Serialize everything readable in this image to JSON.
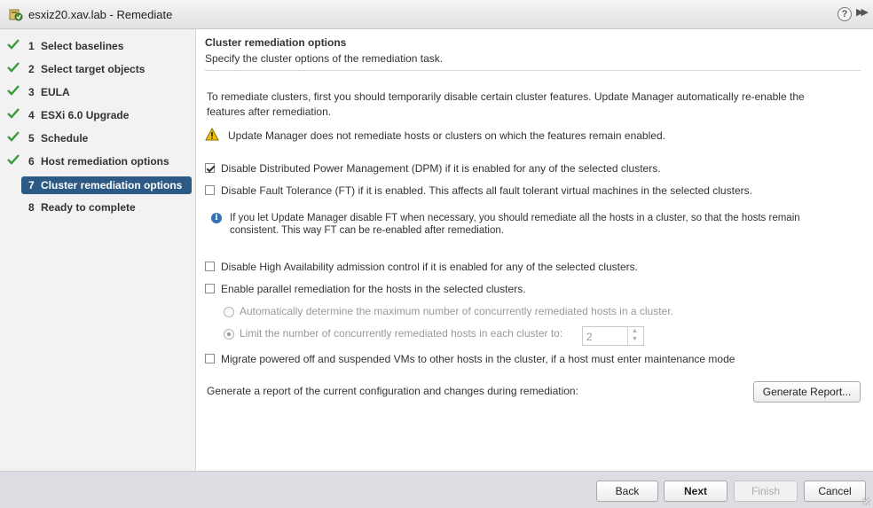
{
  "window": {
    "title": "esxiz20.xav.lab - Remediate",
    "icons": [
      "host-remediate-icon",
      "help-icon",
      "expand-icon"
    ]
  },
  "sidebar": {
    "steps": [
      {
        "num": "1",
        "label": "Select baselines",
        "state": "completed"
      },
      {
        "num": "2",
        "label": "Select target objects",
        "state": "completed"
      },
      {
        "num": "3",
        "label": "EULA",
        "state": "completed"
      },
      {
        "num": "4",
        "label": "ESXi 6.0 Upgrade",
        "state": "completed"
      },
      {
        "num": "5",
        "label": "Schedule",
        "state": "completed"
      },
      {
        "num": "6",
        "label": "Host remediation options",
        "state": "completed"
      },
      {
        "num": "7",
        "label": "Cluster remediation options",
        "state": "active"
      },
      {
        "num": "8",
        "label": "Ready to complete",
        "state": "pending"
      }
    ]
  },
  "main": {
    "title": "Cluster remediation options",
    "subtitle": "Specify the cluster options of the remediation task.",
    "intro_line1": "To remediate clusters, first you should temporarily disable certain cluster features. Update Manager automatically re-enable the",
    "intro_line2": "features after remediation.",
    "warning": "Update Manager does not remediate hosts or clusters on which the features remain enabled.",
    "options": {
      "dpm": {
        "label": "Disable Distributed Power Management (DPM) if it is enabled for any of the selected clusters.",
        "checked": true
      },
      "ft": {
        "label": "Disable Fault Tolerance (FT) if it is enabled. This affects all fault tolerant virtual machines in the selected clusters.",
        "checked": false
      },
      "ft_info_line1": "If you let Update Manager disable FT when necessary, you should remediate all the hosts in a cluster, so that the hosts remain",
      "ft_info_line2": "consistent. This way FT can be re-enabled after remediation.",
      "ha": {
        "label": "Disable High Availability admission control if it is enabled for any of the selected clusters.",
        "checked": false
      },
      "parallel": {
        "label": "Enable parallel remediation for the hosts in the selected clusters.",
        "checked": false
      },
      "auto_radio": {
        "label": "Automatically determine the maximum number of concurrently remediated hosts in a cluster.",
        "selected": false
      },
      "limit_radio": {
        "label": "Limit the number of concurrently remediated hosts in each cluster to:",
        "selected": true
      },
      "limit_value": "2",
      "migrate": {
        "label": "Migrate powered off and suspended VMs to other hosts in the cluster, if a host must enter maintenance mode",
        "checked": false
      }
    },
    "report_text": "Generate a report of the current configuration and changes during remediation:",
    "report_button": "Generate Report..."
  },
  "footer": {
    "back": "Back",
    "next": "Next",
    "finish": "Finish",
    "cancel": "Cancel"
  },
  "colors": {
    "active_step_bg": "#2c5a84",
    "check_green": "#3a9b3a",
    "info_blue": "#2f72b5",
    "warning_yellow": "#f2c200"
  }
}
